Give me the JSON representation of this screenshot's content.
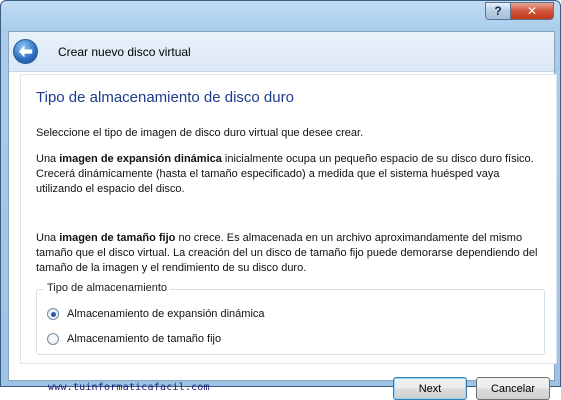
{
  "window": {
    "help_label": "?",
    "close_label": "✕"
  },
  "wizard": {
    "back_icon": "back-arrow-icon",
    "title": "Crear nuevo disco virtual"
  },
  "page": {
    "title": "Tipo de almacenamiento de disco duro",
    "intro": "Seleccione el tipo de imagen de disco duro virtual que desee crear.",
    "dynamic_para": {
      "prefix": "Una ",
      "bold": "imagen de expansión dinámica",
      "suffix": " inicialmente ocupa un pequeño espacio de su disco duro físico. Crecerá dinámicamente (hasta el tamaño especificado) a medida que el sistema huésped vaya utilizando el espacio del disco."
    },
    "fixed_para": {
      "prefix": "Una ",
      "bold": "imagen de tamaño fijo",
      "suffix": " no crece. Es almacenada en un archivo aproximandamente del mismo tamaño que el disco virtual. La creación del un disco de tamaño fijo puede demorarse dependiendo del tamaño de la imagen y el rendimiento de su disco duro."
    }
  },
  "storage_group": {
    "legend": "Tipo de almacenamiento",
    "options": [
      {
        "label": "Almacenamiento de expansión dinámica",
        "selected": true
      },
      {
        "label": "Almacenamiento de tamaño fijo",
        "selected": false
      }
    ]
  },
  "footer": {
    "watermark": "www.tuinformaticafacil.com",
    "next_label": "Next",
    "cancel_label": "Cancelar"
  }
}
